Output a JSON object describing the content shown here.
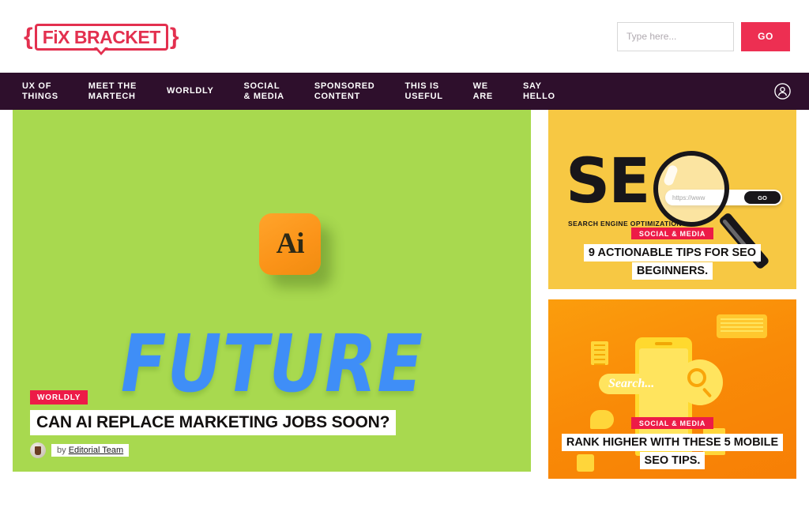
{
  "header": {
    "logo": {
      "brace_left": "{",
      "brace_right": "}",
      "text": "FiX BRACKET"
    },
    "search": {
      "placeholder": "Type here...",
      "value": "",
      "go_label": "GO"
    }
  },
  "nav": {
    "items": [
      {
        "label": "UX OF\nTHINGS"
      },
      {
        "label": "MEET THE\nMARTECH"
      },
      {
        "label": "WORLDLY"
      },
      {
        "label": "SOCIAL\n& MEDIA"
      },
      {
        "label": "SPONSORED\nCONTENT"
      },
      {
        "label": "THIS IS\nUSEFUL"
      },
      {
        "label": "WE\nARE"
      },
      {
        "label": "SAY\nHELLO"
      }
    ],
    "account_icon": "user-account-icon"
  },
  "hero": {
    "category": "WORLDLY",
    "title": "CAN AI REPLACE MARKETING JOBS SOON?",
    "byline_prefix": "by",
    "author": "Editorial Team",
    "art": {
      "ai_badge_text": "Ai",
      "headline_word": "FUTURE",
      "background_color": "#a8d94f",
      "word_color": "#3f8ef7",
      "badge_color": "#fb9318"
    }
  },
  "sidebar": {
    "cards": [
      {
        "category": "SOCIAL & MEDIA",
        "title": "9 ACTIONABLE TIPS FOR SEO BEGINNERS.",
        "art": {
          "letters": "SE",
          "subtitle": "SEARCH ENGINE OPTIMIZATION",
          "search_url": "https://www",
          "search_go": "GO",
          "background_color": "#f7c843"
        }
      },
      {
        "category": "SOCIAL & MEDIA",
        "title": "RANK HIGHER WITH THESE 5 MOBILE SEO TIPS.",
        "art": {
          "search_placeholder": "Search...",
          "background_color": "#f98a07"
        }
      }
    ]
  },
  "colors": {
    "accent_red": "#ed1b47",
    "go_red": "#ed2f52",
    "nav_purple": "#2e0f2c",
    "logo_red": "#e3304f"
  }
}
